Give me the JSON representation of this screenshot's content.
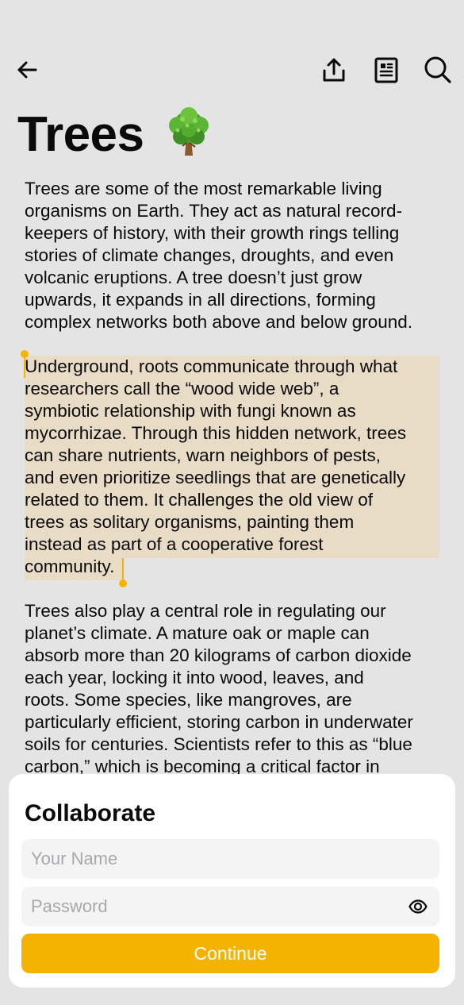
{
  "note": {
    "title": "Trees",
    "title_emoji": "🌳",
    "paragraphs": [
      "Trees are some of the most remarkable living\norganisms on Earth. They act as natural record-\nkeepers of history, with their growth rings telling\nstories of climate changes, droughts, and even\nvolcanic eruptions. A tree doesn’t just grow\nupwards, it expands in all directions, forming\ncomplex networks both above and below ground.",
      "Underground, roots communicate through what\nresearchers call the “wood wide web”, a\nsymbiotic relationship with fungi known as\nmycorrhizae. Through this hidden network, trees\ncan share nutrients, warn neighbors of pests,\nand even prioritize seedlings that are genetically\nrelated to them. It challenges the old view of\ntrees as solitary organisms, painting them\ninstead as part of a cooperative forest\ncommunity.",
      "Trees also play a central role in regulating our\nplanet’s climate. A mature oak or maple can\nabsorb more than 20 kilograms of carbon dioxide\neach year, locking it into wood, leaves, and\nroots. Some species, like mangroves, are\nparticularly efficient, storing carbon in underwater\nsoils for centuries. Scientists refer to this as “blue\ncarbon,” which is becoming a critical factor in"
    ],
    "selected_paragraph_index": 1
  },
  "toolbar": {
    "icons": [
      "back-arrow-icon",
      "share-icon",
      "reader-icon",
      "search-icon"
    ]
  },
  "collaborate": {
    "title": "Collaborate",
    "name_placeholder": "Your Name",
    "password_placeholder": "Password",
    "continue_label": "Continue"
  },
  "colors": {
    "accent": "#f5b301",
    "selection": "#e8dcc6",
    "background": "#e4e4e4",
    "sheet": "#ffffff"
  }
}
